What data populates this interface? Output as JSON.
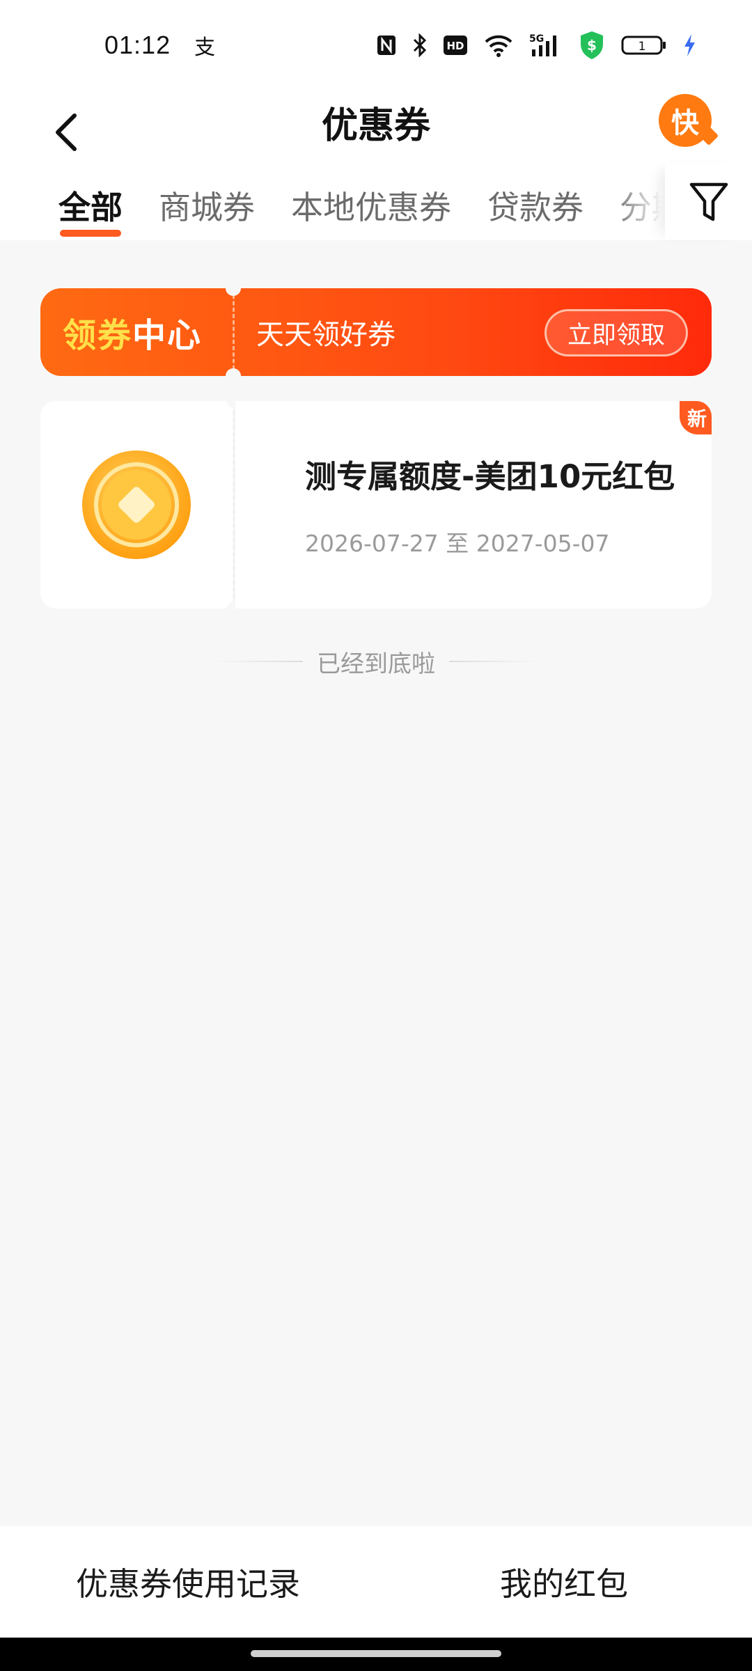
{
  "status_bar": {
    "time": "01:12",
    "alipay_glyph": "支",
    "battery_level": "1",
    "network_label": "5G",
    "hd_label": "HD",
    "shield_symbol": "$",
    "icons": [
      "nfc-icon",
      "bluetooth-icon",
      "hd-icon",
      "wifi-icon",
      "signal-5g-icon",
      "security-shield-icon",
      "battery-icon",
      "charging-icon"
    ]
  },
  "header": {
    "title": "优惠券",
    "kuai_badge": "快",
    "tabs": [
      {
        "label": "全部",
        "active": true
      },
      {
        "label": "商城券",
        "active": false
      },
      {
        "label": "本地优惠券",
        "active": false
      },
      {
        "label": "贷款券",
        "active": false
      },
      {
        "label": "分期",
        "active": false
      }
    ]
  },
  "banner": {
    "title_part1": "领券",
    "title_part2": "中心",
    "subtitle": "天天领好券",
    "button_label": "立即领取",
    "colors": {
      "start": "#ff6a12",
      "end": "#ff2a0a",
      "title_highlight": "#ffe04a"
    }
  },
  "coupons": [
    {
      "title": "测专属额度-美团10元红包",
      "dates": "2026-07-27 至 2027-05-07",
      "badge": "新",
      "icon": "gold-coin-icon"
    }
  ],
  "list_end_text": "已经到底啦",
  "bottom_bar": {
    "left_label": "优惠券使用记录",
    "right_label": "我的红包"
  },
  "accent_color": "#ff5a1f"
}
